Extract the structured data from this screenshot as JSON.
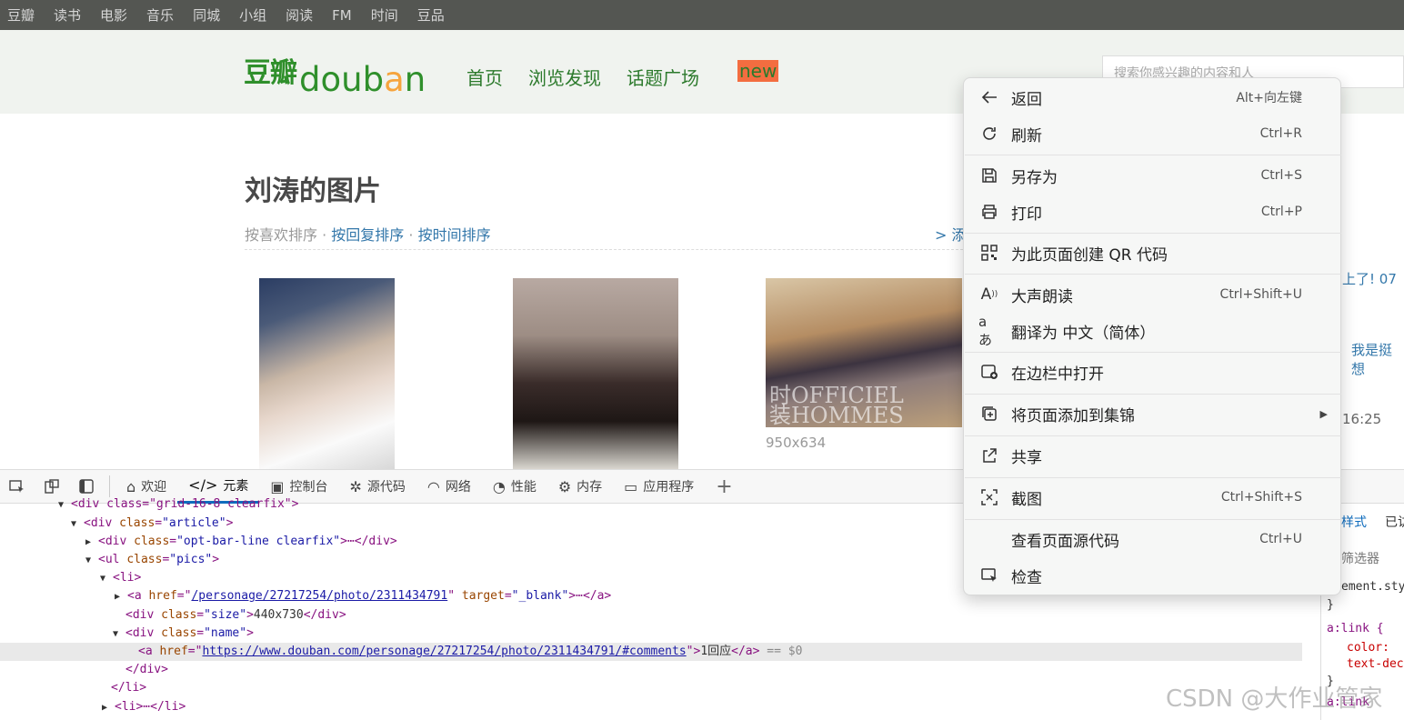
{
  "topnav": [
    "豆瓣",
    "读书",
    "电影",
    "音乐",
    "同城",
    "小组",
    "阅读",
    "FM",
    "时间",
    "豆品"
  ],
  "logo": {
    "cn": "豆瓣",
    "en_a": "d",
    "en_o1": "o",
    "en_u": "u",
    "en_b": "b",
    "en_o2": "a",
    "en_n": "n"
  },
  "mainnav": {
    "home": "首页",
    "browse": "浏览发现",
    "topics": "话题广场",
    "new_badge": "new"
  },
  "search": {
    "placeholder": "搜索你感兴趣的内容和人"
  },
  "page": {
    "title": "刘涛的图片",
    "sort_label": "按喜欢排序",
    "sort_sep": " · ",
    "sort_reply": "按回复排序",
    "sort_time": "按时间排序",
    "add_link": "> 添"
  },
  "photos": [
    {
      "size": "950x634",
      "mag": "时OFFICIEL\n装HOMMES"
    }
  ],
  "right_fragments": {
    "a": "上了!  07",
    "b": "我是挺想",
    "c": "16:25",
    "d": "样式",
    "e": "已访",
    "f": "筛选器"
  },
  "devtools": {
    "tabs": [
      {
        "icon": "⌂",
        "label": "欢迎"
      },
      {
        "icon": "</>",
        "label": "元素"
      },
      {
        "icon": "▣",
        "label": "控制台"
      },
      {
        "icon": "✲",
        "label": "源代码"
      },
      {
        "icon": "◠",
        "label": "网络"
      },
      {
        "icon": "◔",
        "label": "性能"
      },
      {
        "icon": "⚙",
        "label": "内存"
      },
      {
        "icon": "▭",
        "label": "应用程序"
      }
    ],
    "add": "+",
    "code": {
      "l0": "<div class=\"grid-16-8 clearfix\">",
      "l1_open": "<div ",
      "l1_attr": "class",
      "l1_val": "\"article\"",
      "l1_close": ">",
      "l2_tag": "<div ",
      "l2_attr": "class",
      "l2_val": "\"opt-bar-line clearfix\"",
      "l2_end": ">⋯</div>",
      "l3_tag": "<ul ",
      "l3_attr": "class",
      "l3_val": "\"pics\"",
      "l3_end": ">",
      "l4": "<li>",
      "l5_tag": "<a ",
      "l5_attr1": "href",
      "l5_link": "/personage/27217254/photo/2311434791",
      "l5_attr2": "target",
      "l5_val2": "\"_blank\"",
      "l5_end": ">⋯</a>",
      "l6_tag": "<div ",
      "l6_attr": "class",
      "l6_val": "\"size\"",
      "l6_text": "440x730",
      "l6_end": "</div>",
      "l7_tag": "<div ",
      "l7_attr": "class",
      "l7_val": "\"name\"",
      "l7_end": ">",
      "l8_tag": "<a ",
      "l8_attr": "href",
      "l8_link": "https://www.douban.com/personage/27217254/photo/2311434791/#comments",
      "l8_text": "1回应",
      "l8_end": "</a>",
      "l8_eq": " == $0",
      "l9": "</div>",
      "l10": "</li>",
      "l11": "<li>⋯</li>"
    },
    "styles": {
      "s1": "ement.sty",
      "s2": "}",
      "s3": "a:link {",
      "s4": "color: ",
      "s5": "text-dec",
      "s6": "}",
      "s7": "a:link"
    }
  },
  "context_menu": [
    {
      "label": "返回",
      "shortcut": "Alt+向左键",
      "icon": "arrow-left"
    },
    {
      "label": "刷新",
      "shortcut": "Ctrl+R",
      "icon": "refresh"
    },
    {
      "label": "另存为",
      "shortcut": "Ctrl+S",
      "icon": "save"
    },
    {
      "label": "打印",
      "shortcut": "Ctrl+P",
      "icon": "print"
    },
    {
      "label": "为此页面创建 QR 代码",
      "shortcut": "",
      "icon": "qr"
    },
    {
      "label": "大声朗读",
      "shortcut": "Ctrl+Shift+U",
      "icon": "read-aloud"
    },
    {
      "label": "翻译为 中文（简体）",
      "shortcut": "",
      "icon": "translate"
    },
    {
      "label": "在边栏中打开",
      "shortcut": "",
      "icon": "sidebar"
    },
    {
      "label": "将页面添加到集锦",
      "shortcut": "",
      "icon": "collections"
    },
    {
      "label": "共享",
      "shortcut": "",
      "icon": "share"
    },
    {
      "label": "截图",
      "shortcut": "Ctrl+Shift+S",
      "icon": "screenshot"
    },
    {
      "label": "查看页面源代码",
      "shortcut": "Ctrl+U",
      "icon": ""
    },
    {
      "label": "检查",
      "shortcut": "",
      "icon": "inspect"
    }
  ],
  "watermark": "CSDN @大作业管家"
}
